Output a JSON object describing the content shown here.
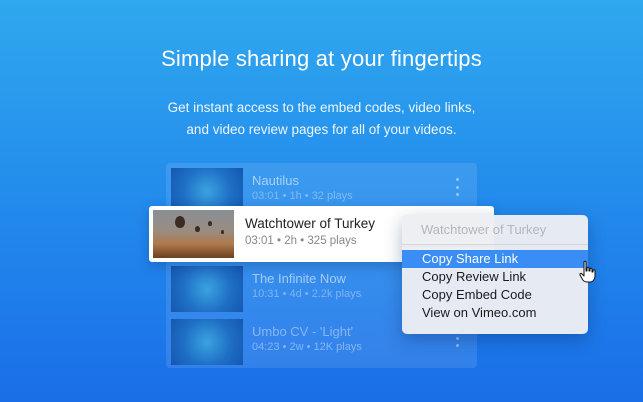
{
  "hero": {
    "title": "Simple sharing at your fingertips",
    "subtitle_line1": "Get instant access to the embed codes, video links,",
    "subtitle_line2": "and video review pages for all of your videos."
  },
  "videos": [
    {
      "title": "Nautilus",
      "meta": "03:01 • 1h • 32 plays"
    },
    {
      "title": "Watchtower of Turkey",
      "meta": "03:01 • 2h • 325 plays"
    },
    {
      "title": "The Infinite Now",
      "meta": "10:31 • 4d • 2.2k plays"
    },
    {
      "title": "Umbo CV - 'Light'",
      "meta": "04:23 • 2w • 12K plays"
    }
  ],
  "context_menu": {
    "header": "Watchtower of Turkey",
    "items": [
      "Copy Share Link",
      "Copy Review Link",
      "Copy Embed Code",
      "View on Vimeo.com"
    ],
    "highlight_color": "#3a8df5"
  },
  "icons": {
    "more": "vertical-ellipsis-icon",
    "cursor": "hand-pointer-icon"
  }
}
